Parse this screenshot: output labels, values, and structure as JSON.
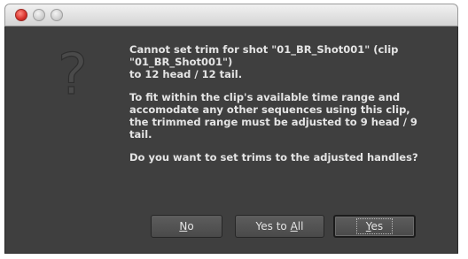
{
  "window": {
    "controls": [
      "close",
      "minimize",
      "zoom"
    ]
  },
  "icon": {
    "name": "question-mark-icon",
    "glyph": "?"
  },
  "message": {
    "p1_line1": "Cannot set trim for shot \"01_BR_Shot001\" (clip",
    "p1_line2": "\"01_BR_Shot001\")",
    "p1_line3": "to 12 head / 12 tail.",
    "p2_line1": "To fit within the clip's available time range and",
    "p2_line2": "accomodate any other sequences using this clip,",
    "p2_line3": "the trimmed range must be adjusted to 9 head / 9",
    "p2_line4": "tail.",
    "p3_line1": "Do you want to set trims to the adjusted handles?"
  },
  "buttons": {
    "no_mnemonic": "N",
    "no_rest": "o",
    "yes_to_all_prefix": "Yes to ",
    "yes_to_all_mnemonic": "A",
    "yes_to_all_rest": "ll",
    "yes_mnemonic": "Y",
    "yes_rest": "es",
    "default": "yes"
  },
  "colors": {
    "dialog_bg": "#3f3f3f",
    "text": "#e4e4e4",
    "close_button": "#d8302a"
  }
}
